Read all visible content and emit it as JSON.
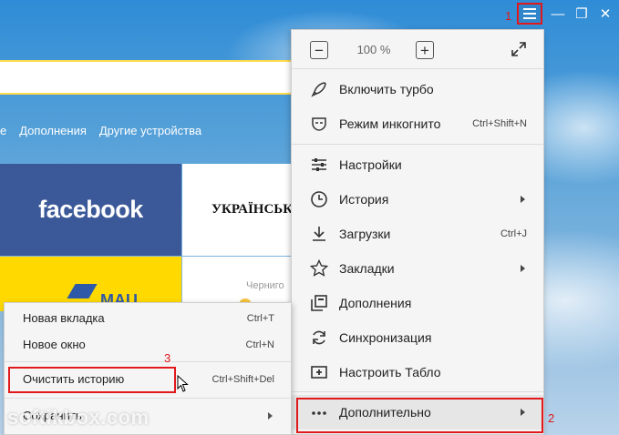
{
  "window": {
    "controls": [
      "menu-icon",
      "minimize-icon",
      "restore-icon",
      "close-icon"
    ],
    "minimize_glyph": "—",
    "restore_glyph": "❐",
    "close_glyph": "✕"
  },
  "annotations": {
    "step1": "1",
    "step2": "2",
    "step3": "3",
    "color": "#e1191c"
  },
  "nav": {
    "links": [
      "е",
      "Дополнения",
      "Другие устройства"
    ]
  },
  "tiles": {
    "facebook": "facebook",
    "ukrainska": "УКРАЇНСЬКА",
    "mau": "MAU",
    "chernigiv": "Черниго"
  },
  "main_menu": {
    "zoom": {
      "minus": "−",
      "value": "100 %",
      "plus": "+"
    },
    "items": [
      {
        "label": "Включить турбо",
        "icon": "rocket-icon"
      },
      {
        "label": "Режим инкогнито",
        "shortcut": "Ctrl+Shift+N",
        "icon": "incognito-mask-icon"
      },
      {
        "label": "Настройки",
        "icon": "settings-sliders-icon"
      },
      {
        "label": "История",
        "icon": "clock-icon",
        "submenu": true
      },
      {
        "label": "Загрузки",
        "shortcut": "Ctrl+J",
        "icon": "download-icon"
      },
      {
        "label": "Закладки",
        "icon": "star-icon",
        "submenu": true
      },
      {
        "label": "Дополнения",
        "icon": "extensions-icon"
      },
      {
        "label": "Синхронизация",
        "icon": "sync-icon"
      },
      {
        "label": "Настроить Табло",
        "icon": "add-tile-icon"
      },
      {
        "label": "Дополнительно",
        "icon": "more-dots-icon",
        "submenu": true
      }
    ]
  },
  "sub_menu": {
    "items": [
      {
        "label": "Новая вкладка",
        "shortcut": "Ctrl+T"
      },
      {
        "label": "Новое окно",
        "shortcut": "Ctrl+N"
      },
      {
        "label": "Очистить историю",
        "shortcut": "Ctrl+Shift+Del"
      },
      {
        "label": "Сохранить",
        "submenu": true
      }
    ]
  },
  "watermark": "softikbox.com"
}
